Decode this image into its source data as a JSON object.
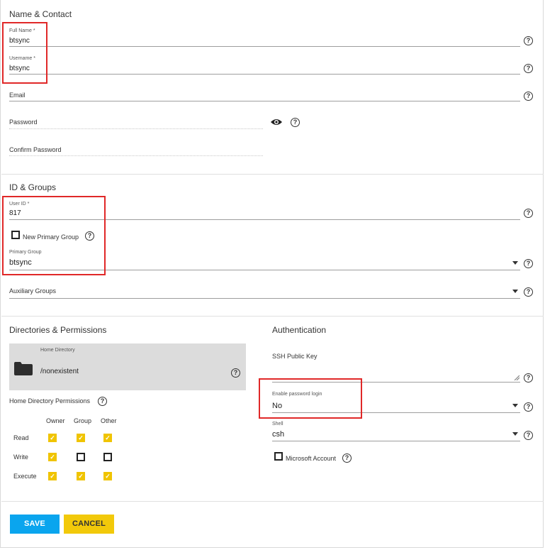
{
  "name_contact": {
    "title": "Name & Contact",
    "full_name_label": "Full Name *",
    "full_name_value": "btsync",
    "username_label": "Username *",
    "username_value": "btsync",
    "email_label": "Email",
    "password_label": "Password",
    "confirm_password_label": "Confirm Password"
  },
  "id_groups": {
    "title": "ID & Groups",
    "user_id_label": "User ID *",
    "user_id_value": "817",
    "new_primary_group_label": "New Primary Group",
    "new_primary_group_checked": false,
    "primary_group_label": "Primary Group",
    "primary_group_value": "btsync",
    "auxiliary_groups_label": "Auxiliary Groups"
  },
  "directories": {
    "title": "Directories & Permissions",
    "home_directory_label": "Home Directory",
    "home_directory_value": "/nonexistent",
    "permissions_label": "Home Directory Permissions",
    "columns": [
      "Owner",
      "Group",
      "Other"
    ],
    "rows": [
      {
        "label": "Read",
        "values": [
          true,
          true,
          true
        ]
      },
      {
        "label": "Write",
        "values": [
          true,
          false,
          false
        ]
      },
      {
        "label": "Execute",
        "values": [
          true,
          true,
          true
        ]
      }
    ]
  },
  "authentication": {
    "title": "Authentication",
    "ssh_key_label": "SSH Public Key",
    "enable_password_label": "Enable password login",
    "enable_password_value": "No",
    "shell_label": "Shell",
    "shell_value": "csh",
    "microsoft_account_label": "Microsoft Account",
    "microsoft_account_checked": false
  },
  "buttons": {
    "save": "SAVE",
    "cancel": "CANCEL"
  },
  "icons": {
    "help": "?",
    "check": "✓"
  },
  "colors": {
    "save_button": "#0aa5ee",
    "cancel_button": "#f2c90a",
    "checkbox_checked": "#f0c400",
    "highlight_box": "#e02828"
  }
}
